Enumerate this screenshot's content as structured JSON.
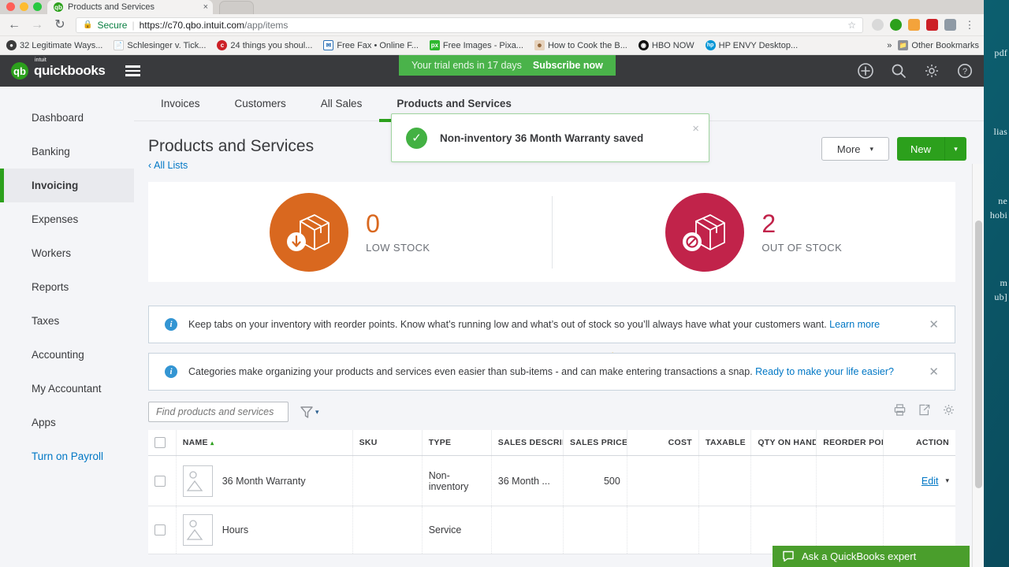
{
  "browser": {
    "tab_title": "Products and Services",
    "tab_close": "×",
    "back": "←",
    "forward": "→",
    "reload": "↻",
    "secure_label": "Secure",
    "url_scheme": "https://",
    "url_host": "c70.qbo.intuit.com",
    "url_path": "/app/items",
    "star": "☆",
    "menu": "⋮",
    "bookmarks": [
      {
        "label": "32 Legitimate Ways...",
        "glyph": "⚑",
        "color": "#3b3b3b"
      },
      {
        "label": "Schlesinger v. Tick...",
        "glyph": "☰",
        "color": "#bdbdbd"
      },
      {
        "label": "24 things you shoul...",
        "glyph": "c",
        "color": "#cc2026"
      },
      {
        "label": "Free Fax • Online F...",
        "glyph": "⎙",
        "color": "#2a6fb5"
      },
      {
        "label": "Free Images - Pixa...",
        "glyph": "px",
        "color": "#2eb82e"
      },
      {
        "label": "How to Cook the B...",
        "glyph": "☘",
        "color": "#c77b3a"
      },
      {
        "label": "HBO NOW",
        "glyph": "◉",
        "color": "#111111"
      },
      {
        "label": "HP ENVY Desktop...",
        "glyph": "hp",
        "color": "#0096d6"
      }
    ],
    "overflow": "»",
    "other_bookmarks": "Other Bookmarks",
    "other_bookmarks_icon": "folder-icon"
  },
  "desktop": {
    "fragments": [
      "pdf",
      "lias",
      "ne",
      "hobi",
      "m",
      "ub]"
    ]
  },
  "appbar": {
    "brand_mark": "qb",
    "brand_sup": "intuit",
    "brand_word": "quickbooks",
    "menu_icon": "hamburger-icon",
    "icons": [
      {
        "name": "add-icon",
        "glyph": "⊕"
      },
      {
        "name": "search-icon",
        "glyph": "⌕"
      },
      {
        "name": "gear-icon",
        "glyph": "⚙"
      },
      {
        "name": "help-icon",
        "glyph": "?"
      }
    ],
    "trial": {
      "message": "Your trial ends in 17 days",
      "cta": "Subscribe now",
      "bg": "#4ab34a"
    }
  },
  "sidebar": {
    "items": [
      {
        "label": "Dashboard",
        "active": false,
        "link": false
      },
      {
        "label": "Banking",
        "active": false,
        "link": false
      },
      {
        "label": "Invoicing",
        "active": true,
        "link": false
      },
      {
        "label": "Expenses",
        "active": false,
        "link": false
      },
      {
        "label": "Workers",
        "active": false,
        "link": false
      },
      {
        "label": "Reports",
        "active": false,
        "link": false
      },
      {
        "label": "Taxes",
        "active": false,
        "link": false
      },
      {
        "label": "Accounting",
        "active": false,
        "link": false
      },
      {
        "label": "My Accountant",
        "active": false,
        "link": false
      },
      {
        "label": "Apps",
        "active": false,
        "link": false
      },
      {
        "label": "Turn on Payroll",
        "active": false,
        "link": true
      }
    ],
    "active_accent": "#2ca01c"
  },
  "tabs": [
    {
      "label": "Invoices",
      "active": false
    },
    {
      "label": "Customers",
      "active": false
    },
    {
      "label": "All Sales",
      "active": false
    },
    {
      "label": "Products and Services",
      "active": true
    }
  ],
  "toast": {
    "message": "Non-inventory 36 Month Warranty saved",
    "check_icon": "check-icon",
    "close": "×",
    "border_color": "#9fd49f",
    "check_color": "#43b143"
  },
  "page": {
    "title": "Products and Services",
    "breadcrumb": "All Lists",
    "breadcrumb_caret": "‹",
    "more_label": "More",
    "more_caret": "▾",
    "new_label": "New",
    "new_caret": "▾",
    "collapse_caret": "⌃"
  },
  "stats": [
    {
      "value": "0",
      "label": "LOW STOCK",
      "color": "#d9681f",
      "badge": "down-arrow-icon"
    },
    {
      "value": "2",
      "label": "OUT OF STOCK",
      "color": "#c1234a",
      "badge": "no-entry-icon"
    }
  ],
  "notices": [
    {
      "text": "Keep tabs on your inventory with reorder points. Know what’s running low and what’s out of stock so you’ll always have what your customers want.",
      "link": "Learn more",
      "close": "✕"
    },
    {
      "text": "Categories make organizing your products and services even easier than sub-items - and can make entering transactions a snap.",
      "link": "Ready to make your life easier?",
      "close": "✕"
    }
  ],
  "list_toolbar": {
    "search_placeholder": "Find products and services",
    "search_value": "",
    "filter_icon": "filter-icon",
    "filter_caret": "▾",
    "print_icon": "print-icon",
    "export_icon": "export-icon",
    "settings_icon": "gear-icon"
  },
  "table": {
    "columns": [
      {
        "label": "NAME",
        "sort": "▴",
        "align": "left"
      },
      {
        "label": "SKU",
        "align": "left"
      },
      {
        "label": "TYPE",
        "align": "left"
      },
      {
        "label": "SALES DESCRIP",
        "align": "left"
      },
      {
        "label": "SALES PRICE",
        "align": "left"
      },
      {
        "label": "COST",
        "align": "right"
      },
      {
        "label": "TAXABLE",
        "align": "left"
      },
      {
        "label": "QTY ON HAND",
        "align": "left"
      },
      {
        "label": "REORDER POIN",
        "align": "left"
      },
      {
        "label": "ACTION",
        "align": "right"
      }
    ],
    "rows": [
      {
        "name": "36 Month Warranty",
        "sku": "",
        "type": "Non-inventory",
        "sales_description": "36 Month ...",
        "sales_price": "500",
        "cost": "",
        "taxable": "",
        "qty_on_hand": "",
        "reorder_point": "",
        "action": "Edit",
        "action_caret": "▾"
      },
      {
        "name": "Hours",
        "sku": "",
        "type": "Service",
        "sales_description": "",
        "sales_price": "",
        "cost": "",
        "taxable": "",
        "qty_on_hand": "",
        "reorder_point": "",
        "action": "",
        "action_caret": ""
      }
    ]
  },
  "chat": {
    "label": "Ask a QuickBooks expert",
    "icon": "chat-bubble-icon",
    "color": "#4a9e2c"
  }
}
